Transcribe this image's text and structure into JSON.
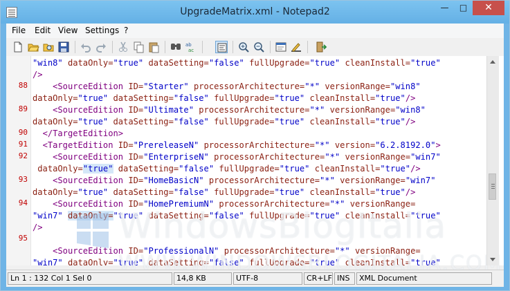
{
  "window": {
    "title": "UpgradeMatrix.xml - Notepad2"
  },
  "menu": {
    "items": [
      "File",
      "Edit",
      "View",
      "Settings",
      "?"
    ]
  },
  "editor": {
    "line_numbers": [
      "88",
      "89",
      "90",
      "91",
      "92",
      "93",
      "94",
      "95"
    ],
    "lines": [
      [
        [
          "v",
          "\"win8\""
        ],
        [
          "p",
          " "
        ],
        [
          "a",
          "dataOnly="
        ],
        [
          "v",
          "\"true\""
        ],
        [
          "p",
          " "
        ],
        [
          "a",
          "dataSetting="
        ],
        [
          "v",
          "\"false\""
        ],
        [
          "p",
          " "
        ],
        [
          "a",
          "fullUpgrade="
        ],
        [
          "v",
          "\"true\""
        ],
        [
          "p",
          " "
        ],
        [
          "a",
          "cleanInstall="
        ],
        [
          "v",
          "\"true\""
        ]
      ],
      [
        [
          "t",
          "/>"
        ]
      ],
      [
        [
          "p",
          "    "
        ],
        [
          "t",
          "<SourceEdition"
        ],
        [
          "p",
          " "
        ],
        [
          "a",
          "ID="
        ],
        [
          "v",
          "\"Starter\""
        ],
        [
          "p",
          " "
        ],
        [
          "a",
          "processorArchitecture="
        ],
        [
          "v",
          "\"*\""
        ],
        [
          "p",
          " "
        ],
        [
          "a",
          "versionRange="
        ],
        [
          "v",
          "\"win8\""
        ]
      ],
      [
        [
          "a",
          "dataOnly="
        ],
        [
          "v",
          "\"true\""
        ],
        [
          "p",
          " "
        ],
        [
          "a",
          "dataSetting="
        ],
        [
          "v",
          "\"false\""
        ],
        [
          "p",
          " "
        ],
        [
          "a",
          "fullUpgrade="
        ],
        [
          "v",
          "\"true\""
        ],
        [
          "p",
          " "
        ],
        [
          "a",
          "cleanInstall="
        ],
        [
          "v",
          "\"true\""
        ],
        [
          "t",
          "/>"
        ]
      ],
      [
        [
          "p",
          "    "
        ],
        [
          "t",
          "<SourceEdition"
        ],
        [
          "p",
          " "
        ],
        [
          "a",
          "ID="
        ],
        [
          "v",
          "\"Ultimate\""
        ],
        [
          "p",
          " "
        ],
        [
          "a",
          "processorArchitecture="
        ],
        [
          "v",
          "\"*\""
        ],
        [
          "p",
          " "
        ],
        [
          "a",
          "versionRange="
        ],
        [
          "v",
          "\"win8\""
        ]
      ],
      [
        [
          "a",
          "dataOnly="
        ],
        [
          "v",
          "\"true\""
        ],
        [
          "p",
          " "
        ],
        [
          "a",
          "dataSetting="
        ],
        [
          "v",
          "\"false\""
        ],
        [
          "p",
          " "
        ],
        [
          "a",
          "fullUpgrade="
        ],
        [
          "v",
          "\"true\""
        ],
        [
          "p",
          " "
        ],
        [
          "a",
          "cleanInstall="
        ],
        [
          "v",
          "\"true\""
        ],
        [
          "t",
          "/>"
        ]
      ],
      [
        [
          "p",
          "  "
        ],
        [
          "t",
          "</TargetEdition>"
        ]
      ],
      [
        [
          "p",
          "  "
        ],
        [
          "t",
          "<TargetEdition"
        ],
        [
          "p",
          " "
        ],
        [
          "a",
          "ID="
        ],
        [
          "v",
          "\"PrereleaseN\""
        ],
        [
          "p",
          " "
        ],
        [
          "a",
          "processorArchitecture="
        ],
        [
          "v",
          "\"*\""
        ],
        [
          "p",
          " "
        ],
        [
          "a",
          "version="
        ],
        [
          "v",
          "\"6.2.8192.0\""
        ],
        [
          "t",
          ">"
        ]
      ],
      [
        [
          "p",
          "    "
        ],
        [
          "t",
          "<SourceEdition"
        ],
        [
          "p",
          " "
        ],
        [
          "a",
          "ID="
        ],
        [
          "v",
          "\"EnterpriseN\""
        ],
        [
          "p",
          " "
        ],
        [
          "a",
          "processorArchitecture="
        ],
        [
          "v",
          "\"*\""
        ],
        [
          "p",
          " "
        ],
        [
          "a",
          "versionRange="
        ],
        [
          "v",
          "\"win7\""
        ]
      ],
      [
        [
          "p",
          " "
        ],
        [
          "a",
          "dataOnly="
        ],
        [
          "vs",
          "\"true\""
        ],
        [
          "p",
          " "
        ],
        [
          "a",
          "dataSetting="
        ],
        [
          "v",
          "\"false\""
        ],
        [
          "p",
          " "
        ],
        [
          "a",
          "fullUpgrade="
        ],
        [
          "v",
          "\"true\""
        ],
        [
          "p",
          " "
        ],
        [
          "a",
          "cleanInstall="
        ],
        [
          "v",
          "\"true\""
        ],
        [
          "t",
          "/>"
        ]
      ],
      [
        [
          "p",
          "    "
        ],
        [
          "t",
          "<SourceEdition"
        ],
        [
          "p",
          " "
        ],
        [
          "a",
          "ID="
        ],
        [
          "v",
          "\"HomeBasicN\""
        ],
        [
          "p",
          " "
        ],
        [
          "a",
          "processorArchitecture="
        ],
        [
          "v",
          "\"*\""
        ],
        [
          "p",
          " "
        ],
        [
          "a",
          "versionRange="
        ],
        [
          "v",
          "\"win7\""
        ]
      ],
      [
        [
          "a",
          "dataOnly="
        ],
        [
          "v",
          "\"true\""
        ],
        [
          "p",
          " "
        ],
        [
          "a",
          "dataSetting="
        ],
        [
          "v",
          "\"false\""
        ],
        [
          "p",
          " "
        ],
        [
          "a",
          "fullUpgrade="
        ],
        [
          "v",
          "\"true\""
        ],
        [
          "p",
          " "
        ],
        [
          "a",
          "cleanInstall="
        ],
        [
          "v",
          "\"true\""
        ],
        [
          "t",
          "/>"
        ]
      ],
      [
        [
          "p",
          "    "
        ],
        [
          "t",
          "<SourceEdition"
        ],
        [
          "p",
          " "
        ],
        [
          "a",
          "ID="
        ],
        [
          "v",
          "\"HomePremiumN\""
        ],
        [
          "p",
          " "
        ],
        [
          "a",
          "processorArchitecture="
        ],
        [
          "v",
          "\"*\""
        ],
        [
          "p",
          " "
        ],
        [
          "a",
          "versionRange="
        ]
      ],
      [
        [
          "v",
          "\"win7\""
        ],
        [
          "p",
          " "
        ],
        [
          "as",
          "dataOnly="
        ],
        [
          "v",
          "\"true\""
        ],
        [
          "p",
          " "
        ],
        [
          "a",
          "dataSetting="
        ],
        [
          "v",
          "\"false\""
        ],
        [
          "p",
          " "
        ],
        [
          "a",
          "fullUpgrade="
        ],
        [
          "v",
          "\"true\""
        ],
        [
          "p",
          " "
        ],
        [
          "a",
          "cleanInstall="
        ],
        [
          "v",
          "\"true\""
        ]
      ],
      [
        [
          "t",
          "/>"
        ]
      ],
      [
        [
          "p",
          ""
        ]
      ],
      [
        [
          "p",
          "    "
        ],
        [
          "t",
          "<SourceEdition"
        ],
        [
          "p",
          " "
        ],
        [
          "a",
          "ID="
        ],
        [
          "v",
          "\"ProfessionalN\""
        ],
        [
          "p",
          " "
        ],
        [
          "a",
          "processorArchitecture="
        ],
        [
          "v",
          "\"*\""
        ],
        [
          "p",
          " "
        ],
        [
          "a",
          "versionRange="
        ]
      ],
      [
        [
          "v",
          "\"win7\""
        ],
        [
          "p",
          " "
        ],
        [
          "a",
          "dataOnly="
        ],
        [
          "v",
          "\"true\""
        ],
        [
          "p",
          " "
        ],
        [
          "a",
          "dataSetting="
        ],
        [
          "v",
          "\"false\""
        ],
        [
          "p",
          " "
        ],
        [
          "a",
          "fullUpgrade="
        ],
        [
          "v",
          "\"true\""
        ],
        [
          "p",
          " "
        ],
        [
          "a",
          "cleanInstall="
        ],
        [
          "v",
          "\"true\""
        ]
      ],
      [
        [
          "t",
          "/>"
        ]
      ]
    ]
  },
  "watermark": {
    "title": "WindowsBlogItalia",
    "subtitle": "WWW.WINDOWSBLOGITALIA.COM"
  },
  "status": {
    "position": "Ln 1 : 132   Col 1   Sel 0",
    "size": "14,8 KB",
    "encoding": "UTF-8",
    "line_endings": "CR+LF",
    "mode": "INS",
    "doc_type": "XML Document"
  },
  "colors": {
    "tag": "#800080",
    "attr": "#8a1f11",
    "value": "#0000c8",
    "line_number": "#c00000",
    "title_bar": "#6fb4e6",
    "close_button": "#c7504b"
  }
}
